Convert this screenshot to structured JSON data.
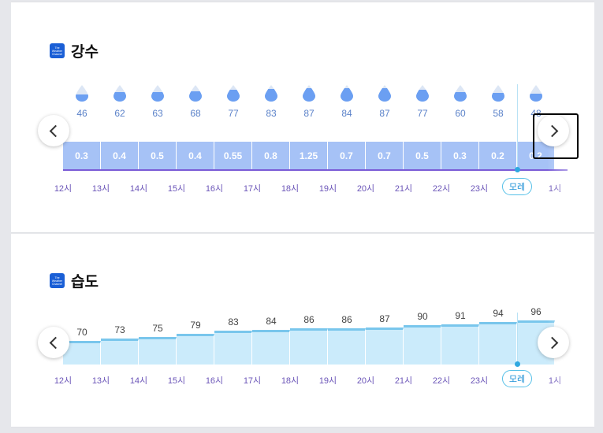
{
  "precip": {
    "title": "강수",
    "logo_text": [
      "The",
      "Weather",
      "Channel"
    ],
    "probabilities": [
      "46",
      "62",
      "63",
      "68",
      "77",
      "83",
      "87",
      "84",
      "87",
      "77",
      "60",
      "58",
      "48"
    ],
    "amounts": [
      "0.3",
      "0.4",
      "0.5",
      "0.4",
      "0.55",
      "0.8",
      "1.25",
      "0.7",
      "0.7",
      "0.5",
      "0.3",
      "0.2",
      "0.2"
    ],
    "hours": [
      "12시",
      "13시",
      "14시",
      "15시",
      "16시",
      "17시",
      "18시",
      "19시",
      "20시",
      "21시",
      "22시",
      "23시",
      "모레",
      "1시"
    ]
  },
  "humidity": {
    "title": "습도",
    "logo_text": [
      "The",
      "Weather",
      "Channel"
    ],
    "values": [
      "70",
      "73",
      "75",
      "79",
      "83",
      "84",
      "86",
      "86",
      "87",
      "90",
      "91",
      "94",
      "96"
    ],
    "hours": [
      "12시",
      "13시",
      "14시",
      "15시",
      "16시",
      "17시",
      "18시",
      "19시",
      "20시",
      "21시",
      "22시",
      "23시",
      "모레",
      "1시"
    ]
  },
  "colors": {
    "drop": "#6b9ff2",
    "bar": "#a6c2f6",
    "hour_text": "#6b55b8",
    "humidity_fill": "#cbebfb",
    "humidity_line": "#79c6ec",
    "accent": "#55c0e8"
  },
  "icons": {
    "prev": "chevron-left-icon",
    "next": "chevron-right-icon",
    "drop": "raindrop-icon"
  }
}
